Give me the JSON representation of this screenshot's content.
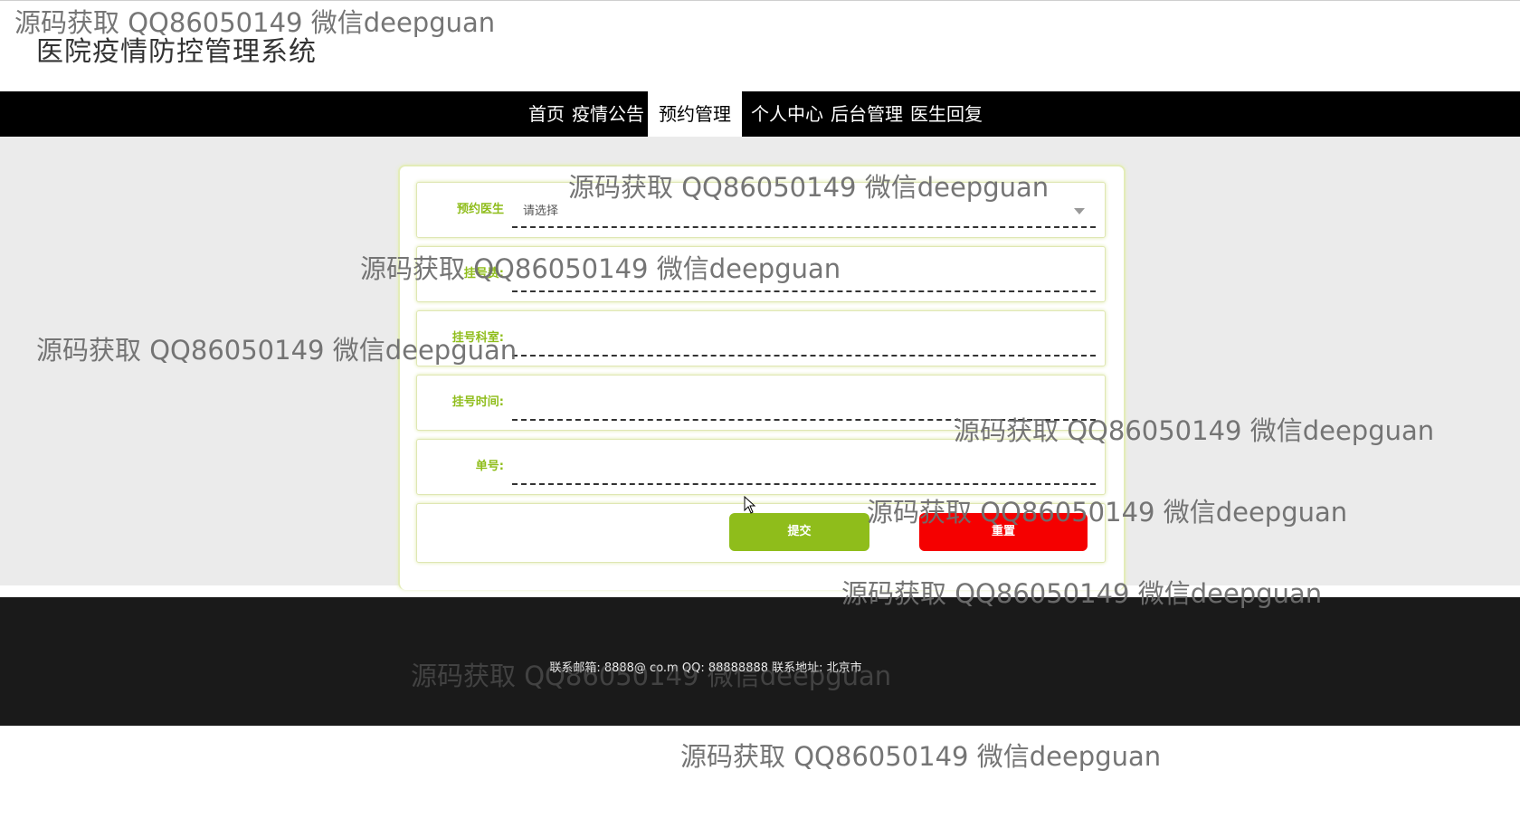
{
  "site": {
    "title": "医院疫情防控管理系统"
  },
  "nav": {
    "items": [
      "首页",
      "疫情公告",
      "预约管理",
      "个人中心",
      "后台管理",
      "医生回复"
    ],
    "active_index": 2
  },
  "form": {
    "doctor_label": "预约医生",
    "doctor_placeholder": "请选择",
    "fee_label": "挂号费:",
    "dept_label": "挂号科室:",
    "time_label": "挂号时间:",
    "order_label": "单号:",
    "submit_label": "提交",
    "reset_label": "重置"
  },
  "footer": {
    "contact": "联系邮箱: 8888@ co.m QQ: 88888888 联系地址: 北京市"
  },
  "watermark": {
    "text": "源码获取 QQ86050149 微信deepguan"
  },
  "colors": {
    "nav_bg": "#000000",
    "accent_green": "#8fbd1b",
    "reset_red": "#f50000",
    "footer_bg": "#1a1a1a",
    "main_bg": "#ebebeb"
  }
}
